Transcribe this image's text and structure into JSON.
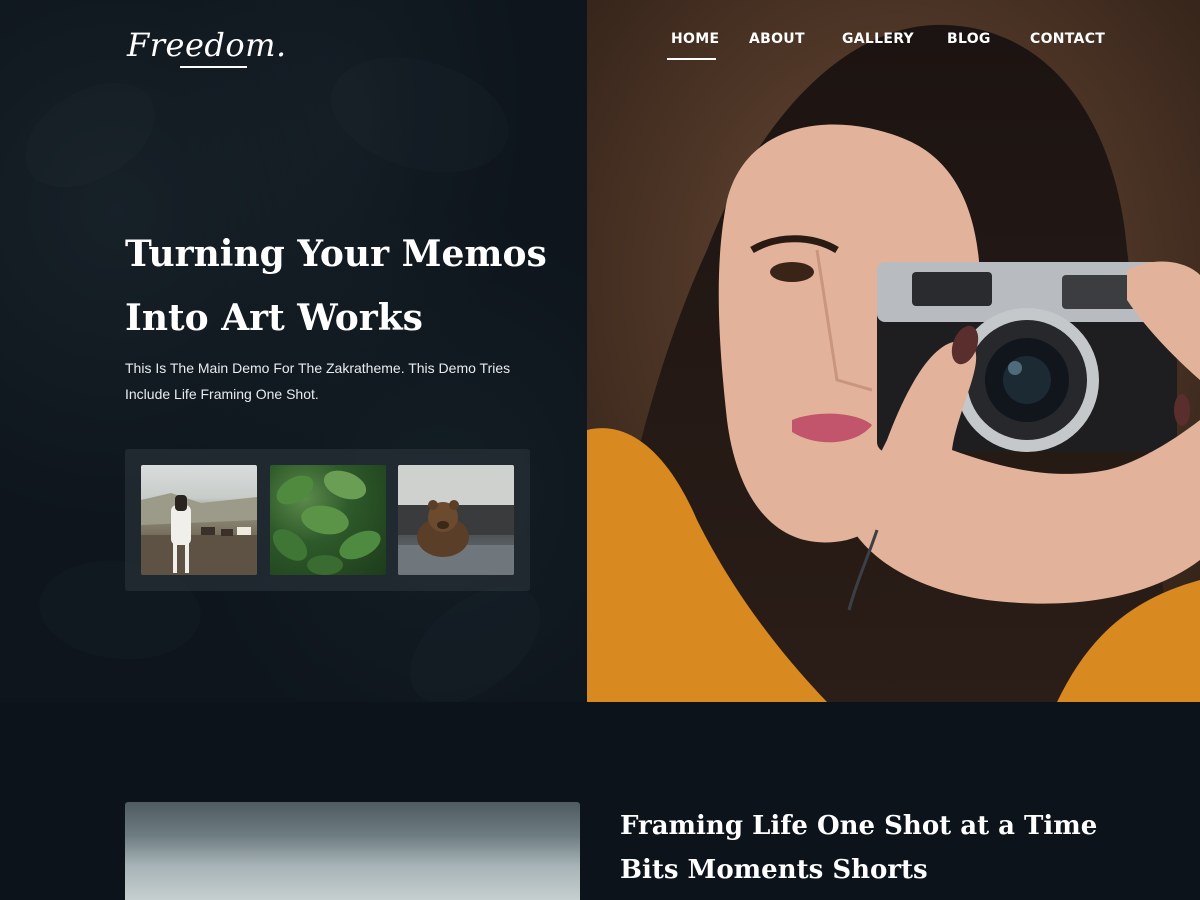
{
  "brand": {
    "logo": "Freedom."
  },
  "nav": {
    "items": [
      {
        "label": "HOME",
        "active": true
      },
      {
        "label": "ABOUT",
        "active": false
      },
      {
        "label": "GALLERY",
        "active": false
      },
      {
        "label": "BLOG",
        "active": false
      },
      {
        "label": "CONTACT",
        "active": false
      }
    ]
  },
  "hero": {
    "title_line1": "Turning Your Memos",
    "title_line2": "Into Art Works",
    "desc_line1": "This Is The Main Demo For The Zakratheme. This Demo Tries",
    "desc_line2": "Include Life Framing One Shot."
  },
  "gallery_thumbs": [
    {
      "subject": "horses"
    },
    {
      "subject": "leaves"
    },
    {
      "subject": "bear"
    }
  ],
  "about": {
    "title_line1": "Framing Life One Shot at a Time",
    "title_line2": "Bits Moments Shorts"
  },
  "colors": {
    "background": "#0c131b",
    "text": "#ffffff",
    "jacket_orange": "#d8891f"
  }
}
